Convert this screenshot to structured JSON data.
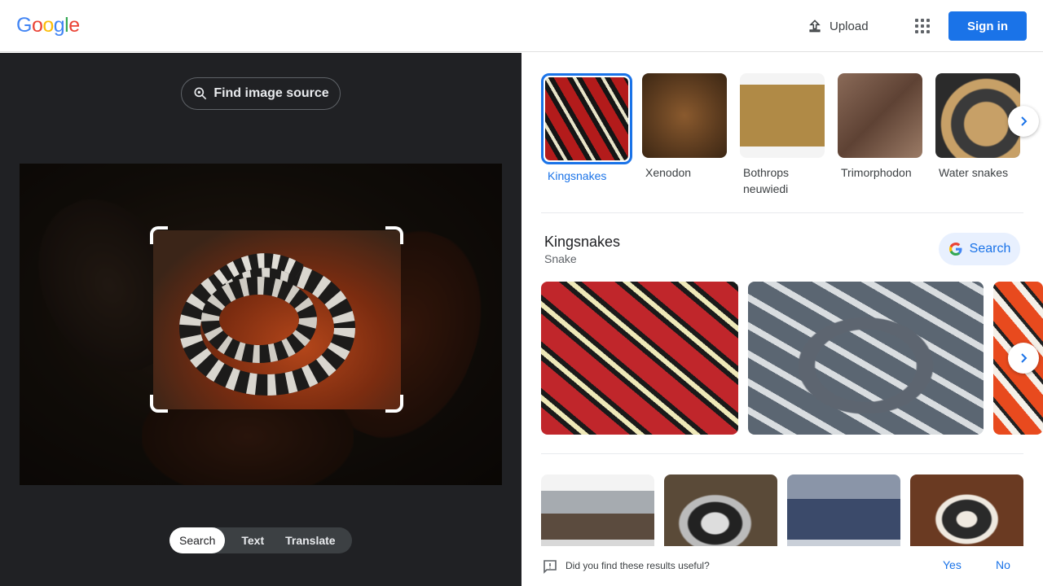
{
  "header": {
    "logo": [
      "G",
      "o",
      "o",
      "g",
      "l",
      "e"
    ],
    "logo_colors": [
      "#4285f4",
      "#ea4335",
      "#fbbc05",
      "#4285f4",
      "#34a853",
      "#ea4335"
    ],
    "upload_label": "Upload",
    "apps_icon": "apps-grid-icon",
    "signin_label": "Sign in"
  },
  "left": {
    "find_source_label": "Find image source",
    "modes": [
      {
        "label": "Search",
        "active": true
      },
      {
        "label": "Text",
        "active": false
      },
      {
        "label": "Translate",
        "active": false
      }
    ]
  },
  "matches": [
    {
      "label": "Kingsnakes",
      "active": true
    },
    {
      "label": "Xenodon",
      "active": false
    },
    {
      "label": "Bothrops\nneuwiedi",
      "active": false
    },
    {
      "label": "Trimorphodon",
      "active": false
    },
    {
      "label": "Water snakes",
      "active": false
    }
  ],
  "knowledge": {
    "title": "Kingsnakes",
    "subtitle": "Snake",
    "search_label": "Search"
  },
  "feedback": {
    "question": "Did you find these results useful?",
    "yes": "Yes",
    "no": "No"
  },
  "colors": {
    "accent": "#1a73e8",
    "dark_panel": "#202124"
  }
}
